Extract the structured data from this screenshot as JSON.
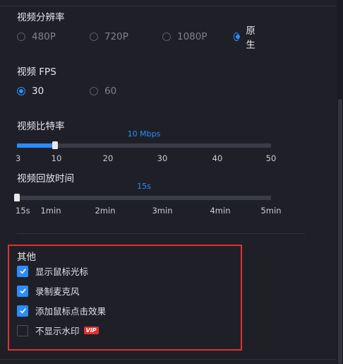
{
  "resolution": {
    "label": "视频分辨率",
    "options": [
      "480P",
      "720P",
      "1080P",
      "原生"
    ],
    "selected": "原生"
  },
  "fps": {
    "label": "视频 FPS",
    "options": [
      "30",
      "60"
    ],
    "selected": "30"
  },
  "bitrate": {
    "label": "视频比特率",
    "value_text": "10 Mbps",
    "value": 10,
    "min": 3,
    "max": 50,
    "ticks": [
      "3",
      "10",
      "20",
      "30",
      "40",
      "50"
    ]
  },
  "playback": {
    "label": "视频回放时间",
    "value_text": "15s",
    "ticks": [
      "15s",
      "1min",
      "2min",
      "3min",
      "4min",
      "5min"
    ]
  },
  "other": {
    "title": "其他",
    "items": [
      {
        "label": "显示鼠标光标",
        "checked": true
      },
      {
        "label": "录制麦克风",
        "checked": true
      },
      {
        "label": "添加鼠标点击效果",
        "checked": true
      },
      {
        "label": "不显示水印",
        "checked": false,
        "badge": "VIP"
      }
    ]
  },
  "colors": {
    "accent": "#2b8cff",
    "highlight_border": "#e0302f",
    "background": "#1f2027"
  }
}
